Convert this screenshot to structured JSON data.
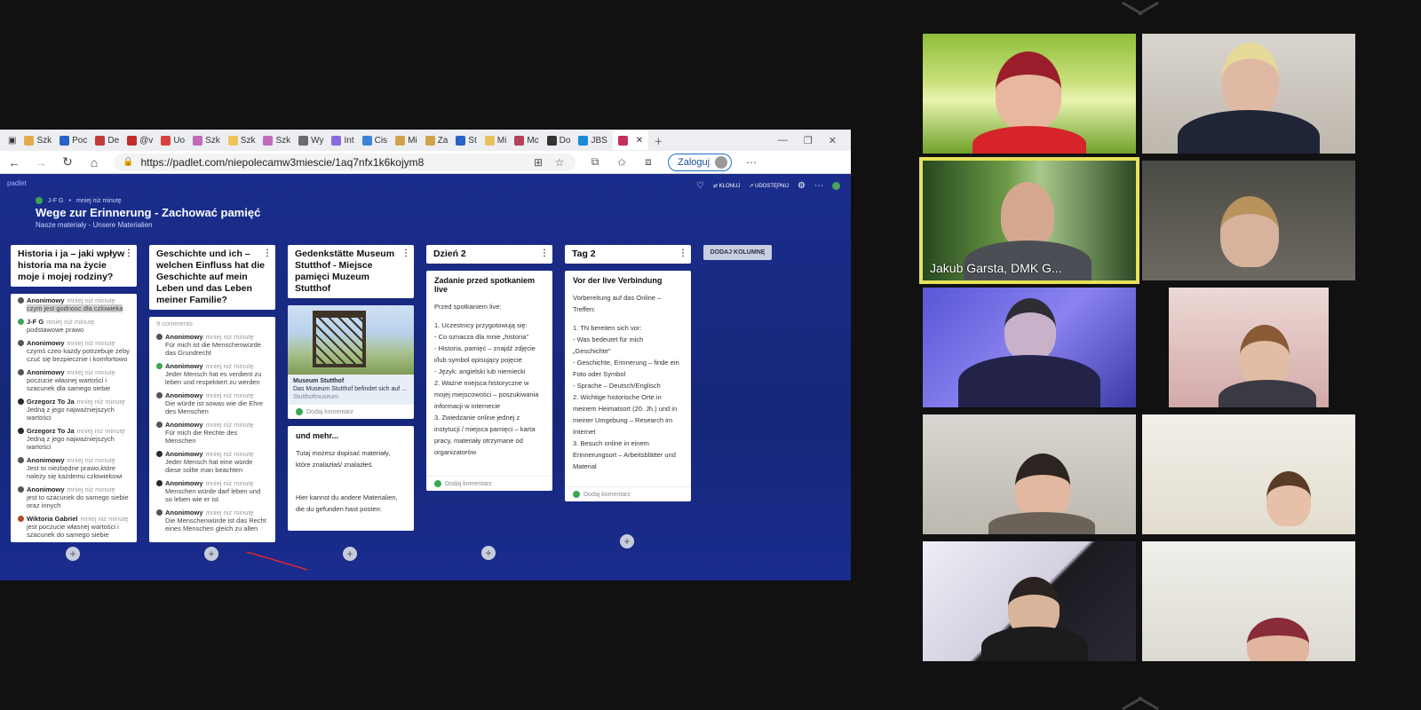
{
  "browser": {
    "tabs": [
      {
        "label": "Szk",
        "color": "#e5a94b"
      },
      {
        "label": "Poc",
        "color": "#2a62c9"
      },
      {
        "label": "De",
        "color": "#c43b3b"
      },
      {
        "label": "@v",
        "color": "#c42b2b"
      },
      {
        "label": "Uo",
        "color": "#d9413d"
      },
      {
        "label": "Szk",
        "color": "#c06ab8"
      },
      {
        "label": "Szk",
        "color": "#f0c45c"
      },
      {
        "label": "Szk",
        "color": "#c06ab8"
      },
      {
        "label": "Wy",
        "color": "#6b6b6b"
      },
      {
        "label": "Int",
        "color": "#8a6ae0"
      },
      {
        "label": "Cis",
        "color": "#3a84d8"
      },
      {
        "label": "Mi",
        "color": "#d1a24a"
      },
      {
        "label": "Za",
        "color": "#d1a24a"
      },
      {
        "label": "St",
        "color": "#2a62c9"
      },
      {
        "label": "Mi",
        "color": "#e5c25a"
      },
      {
        "label": "Mc",
        "color": "#b6405a"
      },
      {
        "label": "Do",
        "color": "#333333"
      },
      {
        "label": "JBS",
        "color": "#1a8ad8"
      }
    ],
    "url": "https://padlet.com/niepolecamw3miescie/1aq7nfx1k6kojym8",
    "login_label": "Zaloguj"
  },
  "padlet": {
    "brand": "padlet",
    "author": "J-F G",
    "time": "mniej niż minutę",
    "title": "Wege zur Erinnerung - Zachować pamięć",
    "subtitle": "Nasze materiały - Unsere Materialien",
    "tool_clone": "KLONUJ",
    "tool_share": "UDOSTĘPNIJ",
    "add_column": "DODAJ KOLUMNĘ",
    "columns": {
      "c1": {
        "title": "Historia i ja – jaki wpływ historia ma na życie moje i mojej rodziny?",
        "comments": [
          {
            "who": "Anonimowy",
            "when": "mniej niż minutę",
            "text": "czym jest godnosc dla czlowieka"
          },
          {
            "who": "J-F G",
            "when": "mniej niż minutę",
            "text": "podstawowe prawo"
          },
          {
            "who": "Anonimowy",
            "when": "mniej niż minutę",
            "text": "czymś czeo każdy potrzebuje żeby czuć się bezpiecznie i komfortowo"
          },
          {
            "who": "Anonimowy",
            "when": "mniej niż minutę",
            "text": "poczucie własnej wartości i szacunek dla samego siebie"
          },
          {
            "who": "Grzegorz To Ja",
            "when": "mniej niż minutę",
            "text": "Jedną z jego najważniejszych wartości"
          },
          {
            "who": "Grzegorz To Ja",
            "when": "mniej niż minutę",
            "text": "Jedną z jego najważniejszych wartości"
          },
          {
            "who": "Anonimowy",
            "when": "mniej niż minutę",
            "text": "Jest to niezbędne prawo,które należy się każdemu człowiekowi"
          },
          {
            "who": "Anonimowy",
            "when": "mniej niż minutę",
            "text": "jest to szacunek do samego siebie oraz innych"
          },
          {
            "who": "Wiktoria Gabriel",
            "when": "mniej niż minutę",
            "text": "jest poczucie własnej wartości i szacunek do samego siebie"
          }
        ]
      },
      "c2": {
        "title": "Geschichte und ich – welchen Einfluss hat die Geschichte auf mein Leben und das Leben meiner Familie?",
        "count": "9 comments",
        "comments": [
          {
            "who": "Anonimowy",
            "when": "mniej niż minutę",
            "text": "Für mich ist die Menschenwürde das Grundrecht"
          },
          {
            "who": "Anonimowy",
            "when": "mniej niż minutę",
            "text": "Jeder Mensch hat es verdient zu leben und respektiert zu werden"
          },
          {
            "who": "Anonimowy",
            "when": "mniej niż minutę",
            "text": "Die würde ist sowas wie die Ehre des Menschen"
          },
          {
            "who": "Anonimowy",
            "when": "mniej niż minutę",
            "text": "Für mich die Rechte des Menschen"
          },
          {
            "who": "Anonimowy",
            "when": "mniej niż minutę",
            "text": "Jeder Mensch hat eine würde diese sollte man beachten"
          },
          {
            "who": "Anonimowy",
            "when": "mniej niż minutę",
            "text": "Menschen würde darf leben und so leben wie er ist"
          },
          {
            "who": "Anonimowy",
            "when": "mniej niż minutę",
            "text": "Die Menschenwürde ist das Recht eines Menschen gleich zu allen"
          }
        ]
      },
      "c3": {
        "title": "Gedenkstätte Museum Stutthof - Miejsce pamięci Muzeum Stutthof",
        "photo_title": "Museum Stutthof",
        "photo_desc": "Das Museum Stutthof befindet sich auf ...",
        "photo_src": "Stutthofmuseum",
        "add_comment": "Dodaj komentarz",
        "card2_title": "und mehr...",
        "card2_p1": "Tutaj możesz dopisać materiały, które znalazłaś/ znalazłeś.",
        "card2_p2": "Hier kannst du andere Materialien, die du gefunden hast posten:"
      },
      "c4": {
        "title": "Dzień 2",
        "card_title": "Zadanie przed spotkaniem live",
        "lines": [
          "Przed spotkaniem live:",
          "1.      Uczestnicy przygotowują się:",
          "-        Co oznacza dla mnie „historia\"",
          "-        Historia, pamięć – znajdź zdjęcie i/lub symbol opisujący pojęcie",
          "-        Język: angielski lub niemiecki",
          "2.      Ważne miejsca historyczne w mojej miejscowości – poszukiwania informacji w internecie",
          "3.      Zwiedzanie online jednej z instytucji / miejsca pamięci – karta pracy, materiały otrzymane od organizatorów"
        ],
        "add_comment": "Dodaj komentarz"
      },
      "c5": {
        "title": "Tag 2",
        "card_title": "Vor der live Verbindung",
        "lines": [
          "Vorbereitung auf das Online – Treffen:",
          "1.      TN bereiten sich vor:",
          "-        Was bedeutet für mich „Geschichte\"",
          "-        Geschichte, Erinnerung – finde ein Foto oder Symbol",
          "-        Sprache – Deutsch/Englisch",
          "2.      Wichtige historische Orte in meinem Heimatsort (20. Jh.) und in meiner Umgebung – Research im Internet",
          "3.      Besuch online in einem Erinnerungsort – Arbeitsblätter und Material"
        ],
        "add_comment": "Dodaj komentarz"
      }
    }
  },
  "participants": {
    "speaker_name": "Jakub Garsta, DMK G..."
  },
  "colors": {
    "speaker_outline": "#e7e25a",
    "padlet_bg": "#1b2d8c"
  }
}
